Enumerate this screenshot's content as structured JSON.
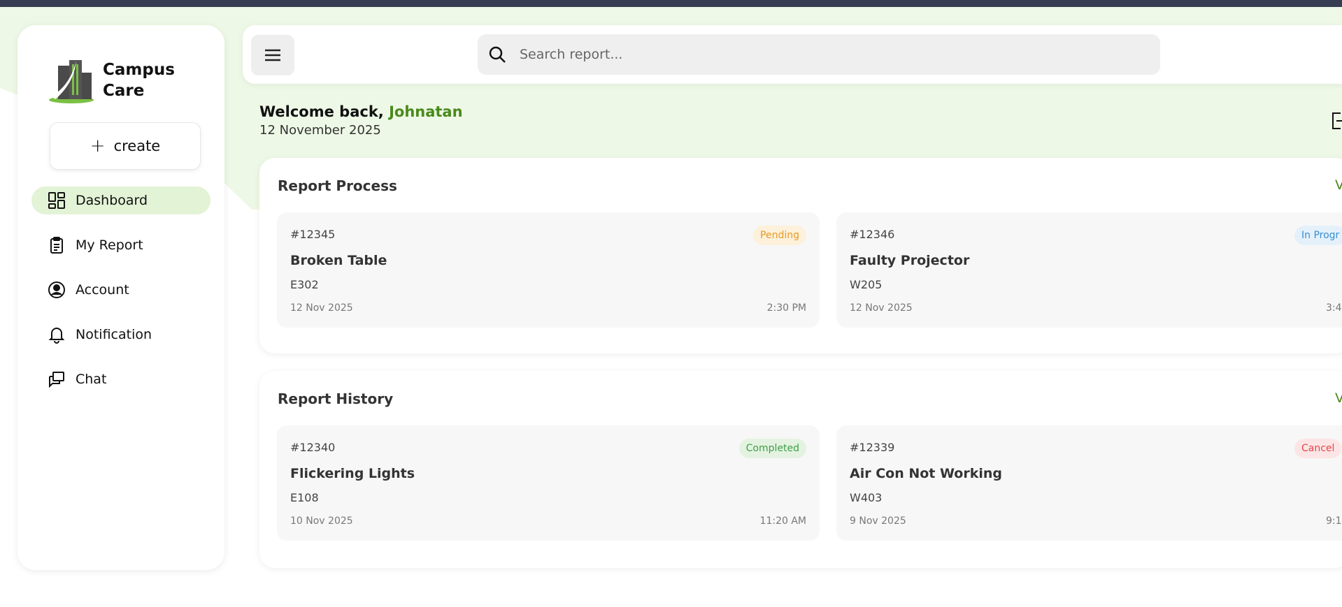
{
  "app": {
    "name": "Campus Care"
  },
  "sidebar": {
    "create_label": "create",
    "items": [
      {
        "label": "Dashboard",
        "icon": "dashboard-icon",
        "active": true
      },
      {
        "label": "My Report",
        "icon": "clipboard-icon"
      },
      {
        "label": "Account",
        "icon": "user-circle-icon"
      },
      {
        "label": "Notification",
        "icon": "bell-icon"
      },
      {
        "label": "Chat",
        "icon": "chat-icon"
      }
    ]
  },
  "header": {
    "search_placeholder": "Search report..."
  },
  "welcome": {
    "greeting": "Welcome back, ",
    "name": "Johnatan",
    "date": "12 November 2025"
  },
  "process": {
    "title": "Report Process",
    "view_label": "V",
    "cards": [
      {
        "id": "#12345",
        "title": "Broken Table",
        "room": "E302",
        "date": "12 Nov 2025",
        "time": "2:30 PM",
        "status": "Pending",
        "status_color": "#e69a23"
      },
      {
        "id": "#12346",
        "title": "Faulty Projector",
        "room": "W205",
        "date": "12 Nov 2025",
        "time": "3:4",
        "status": "In Progr",
        "status_color": "#3a8fd0"
      }
    ]
  },
  "history": {
    "title": "Report History",
    "view_label": "V",
    "cards": [
      {
        "id": "#12340",
        "title": "Flickering Lights",
        "room": "E108",
        "date": "10 Nov 2025",
        "time": "11:20 AM",
        "status": "Completed",
        "status_color": "#3f9e48"
      },
      {
        "id": "#12339",
        "title": "Air Con Not Working",
        "room": "W403",
        "date": "9 Nov 2025",
        "time": "9:1",
        "status": "Cancel",
        "status_color": "#e0474c"
      }
    ]
  },
  "colors": {
    "accent": "#4a8a1c",
    "active_bg": "#e3f3d6",
    "topbar": "#373d52"
  }
}
